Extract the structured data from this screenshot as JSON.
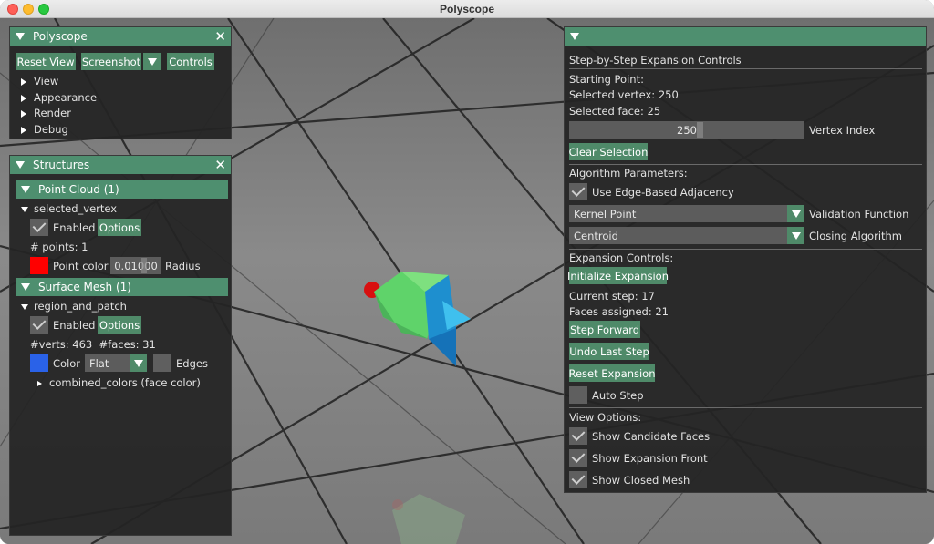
{
  "window": {
    "title": "Polyscope"
  },
  "polyscope_panel": {
    "title": "Polyscope",
    "reset_view": "Reset View",
    "screenshot": "Screenshot",
    "controls": "Controls",
    "tree": [
      "View",
      "Appearance",
      "Render",
      "Debug"
    ]
  },
  "structures_panel": {
    "title": "Structures",
    "point_cloud": {
      "header": "Point Cloud (1)",
      "name": "selected_vertex",
      "enabled_label": "Enabled",
      "options_label": "Options",
      "points_text": "# points: 1",
      "color_label": "Point color",
      "color_hex": "#ff0000",
      "radius_value": "0.01000",
      "radius_label": "Radius"
    },
    "surface_mesh": {
      "header": "Surface Mesh (1)",
      "name": "region_and_patch",
      "enabled_label": "Enabled",
      "options_label": "Options",
      "stats_text": "#verts: 463  #faces: 31",
      "color_label": "Color",
      "color_hex": "#2a62e8",
      "shade_value": "Flat",
      "edges_label": "Edges",
      "quantity": "combined_colors (face color)"
    }
  },
  "expansion_panel": {
    "title": "Step-by-Step Expansion Controls",
    "starting_point": "Starting Point:",
    "selected_vertex": "Selected vertex: 250",
    "selected_face": "Selected face: 25",
    "vertex_index_value": "250",
    "vertex_index_label": "Vertex Index",
    "clear_selection": "Clear Selection",
    "algorithm_params": "Algorithm Parameters:",
    "edge_adjacency": "Use Edge-Based Adjacency",
    "validation_value": "Kernel Point",
    "validation_label": "Validation Function",
    "closing_value": "Centroid",
    "closing_label": "Closing Algorithm",
    "expansion_controls": "Expansion Controls:",
    "initialize": "Initialize Expansion",
    "current_step": "Current step: 17",
    "faces_assigned": "Faces assigned: 21",
    "step_forward": "Step Forward",
    "undo_step": "Undo Last Step",
    "reset_expansion": "Reset Expansion",
    "auto_step": "Auto Step",
    "view_options": "View Options:",
    "show_candidate": "Show Candidate Faces",
    "show_front": "Show Expansion Front",
    "show_closed": "Show Closed Mesh"
  },
  "colors": {
    "accent": "#4f8a69",
    "header": "#4e8f6f",
    "panel_bg": "#242424"
  }
}
